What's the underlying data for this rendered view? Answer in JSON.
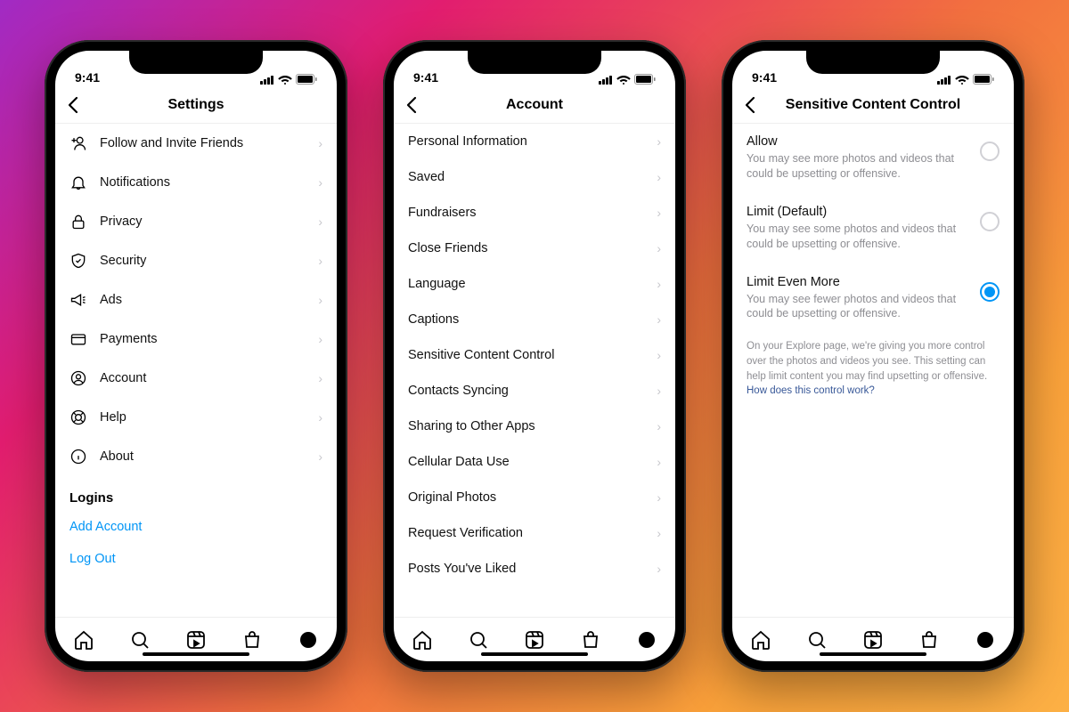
{
  "status": {
    "time": "9:41"
  },
  "phones": [
    {
      "title": "Settings",
      "items": [
        {
          "icon": "add-user",
          "label": "Follow and Invite Friends"
        },
        {
          "icon": "bell",
          "label": "Notifications"
        },
        {
          "icon": "lock",
          "label": "Privacy"
        },
        {
          "icon": "shield",
          "label": "Security"
        },
        {
          "icon": "megaphone",
          "label": "Ads"
        },
        {
          "icon": "card",
          "label": "Payments"
        },
        {
          "icon": "person",
          "label": "Account"
        },
        {
          "icon": "lifebuoy",
          "label": "Help"
        },
        {
          "icon": "info",
          "label": "About"
        }
      ],
      "logins_header": "Logins",
      "links": [
        "Add Account",
        "Log Out"
      ]
    },
    {
      "title": "Account",
      "items": [
        {
          "label": "Personal Information"
        },
        {
          "label": "Saved"
        },
        {
          "label": "Fundraisers"
        },
        {
          "label": "Close Friends"
        },
        {
          "label": "Language"
        },
        {
          "label": "Captions"
        },
        {
          "label": "Sensitive Content Control"
        },
        {
          "label": "Contacts Syncing"
        },
        {
          "label": "Sharing to Other Apps"
        },
        {
          "label": "Cellular Data Use"
        },
        {
          "label": "Original Photos"
        },
        {
          "label": "Request Verification"
        },
        {
          "label": "Posts You've Liked"
        }
      ]
    },
    {
      "title": "Sensitive Content Control",
      "options": [
        {
          "title": "Allow",
          "desc": "You may see more photos and videos that could be upsetting or offensive.",
          "selected": false
        },
        {
          "title": "Limit (Default)",
          "desc": "You may see some photos and videos that could be upsetting or offensive.",
          "selected": false
        },
        {
          "title": "Limit Even More",
          "desc": "You may see fewer photos and videos that could be upsetting or offensive.",
          "selected": true
        }
      ],
      "info": "On your Explore page, we're giving you more control over the photos and videos you see. This setting can help limit content you may find upsetting or offensive. ",
      "info_link": "How does this control work?"
    }
  ]
}
